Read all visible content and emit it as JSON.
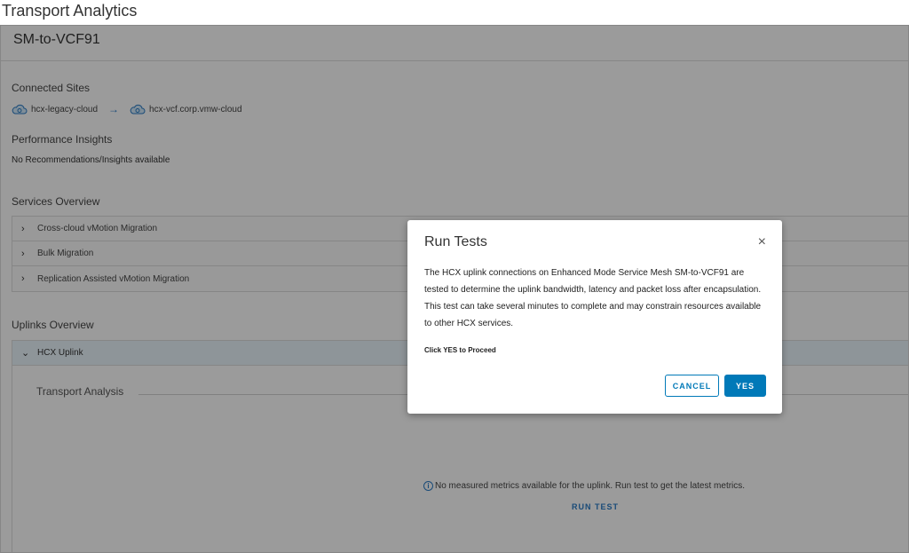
{
  "page": {
    "title": "Transport Analytics"
  },
  "mesh": {
    "name": "SM-to-VCF91"
  },
  "connected_sites": {
    "label": "Connected Sites",
    "source": "hcx-legacy-cloud",
    "arrow": "→",
    "destination": "hcx-vcf.corp.vmw-cloud"
  },
  "insights": {
    "label": "Performance Insights",
    "text": "No Recommendations/Insights available"
  },
  "services": {
    "label": "Services Overview",
    "items": [
      {
        "label": "Cross-cloud vMotion Migration"
      },
      {
        "label": "Bulk Migration"
      },
      {
        "label": "Replication Assisted vMotion Migration"
      }
    ]
  },
  "uplinks": {
    "label": "Uplinks Overview",
    "uplink_name": "HCX Uplink",
    "transport_label": "Transport Analysis",
    "no_metrics": "No measured metrics available for the uplink. Run test to get the latest metrics.",
    "run_test": "RUN TEST"
  },
  "modal": {
    "title": "Run Tests",
    "close": "×",
    "body": "The HCX uplink connections on Enhanced Mode Service Mesh SM-to-VCF91 are tested to determine the uplink bandwidth, latency and packet loss after encapsulation. This test can take several minutes to complete and may constrain resources available to other HCX services.",
    "proceed": "Click YES to Proceed",
    "cancel_label": "CANCEL",
    "yes_label": "YES"
  },
  "colors": {
    "accent": "#0079b8",
    "link": "#2b7ac2",
    "overlay": "rgba(0,0,0,0.38)"
  }
}
